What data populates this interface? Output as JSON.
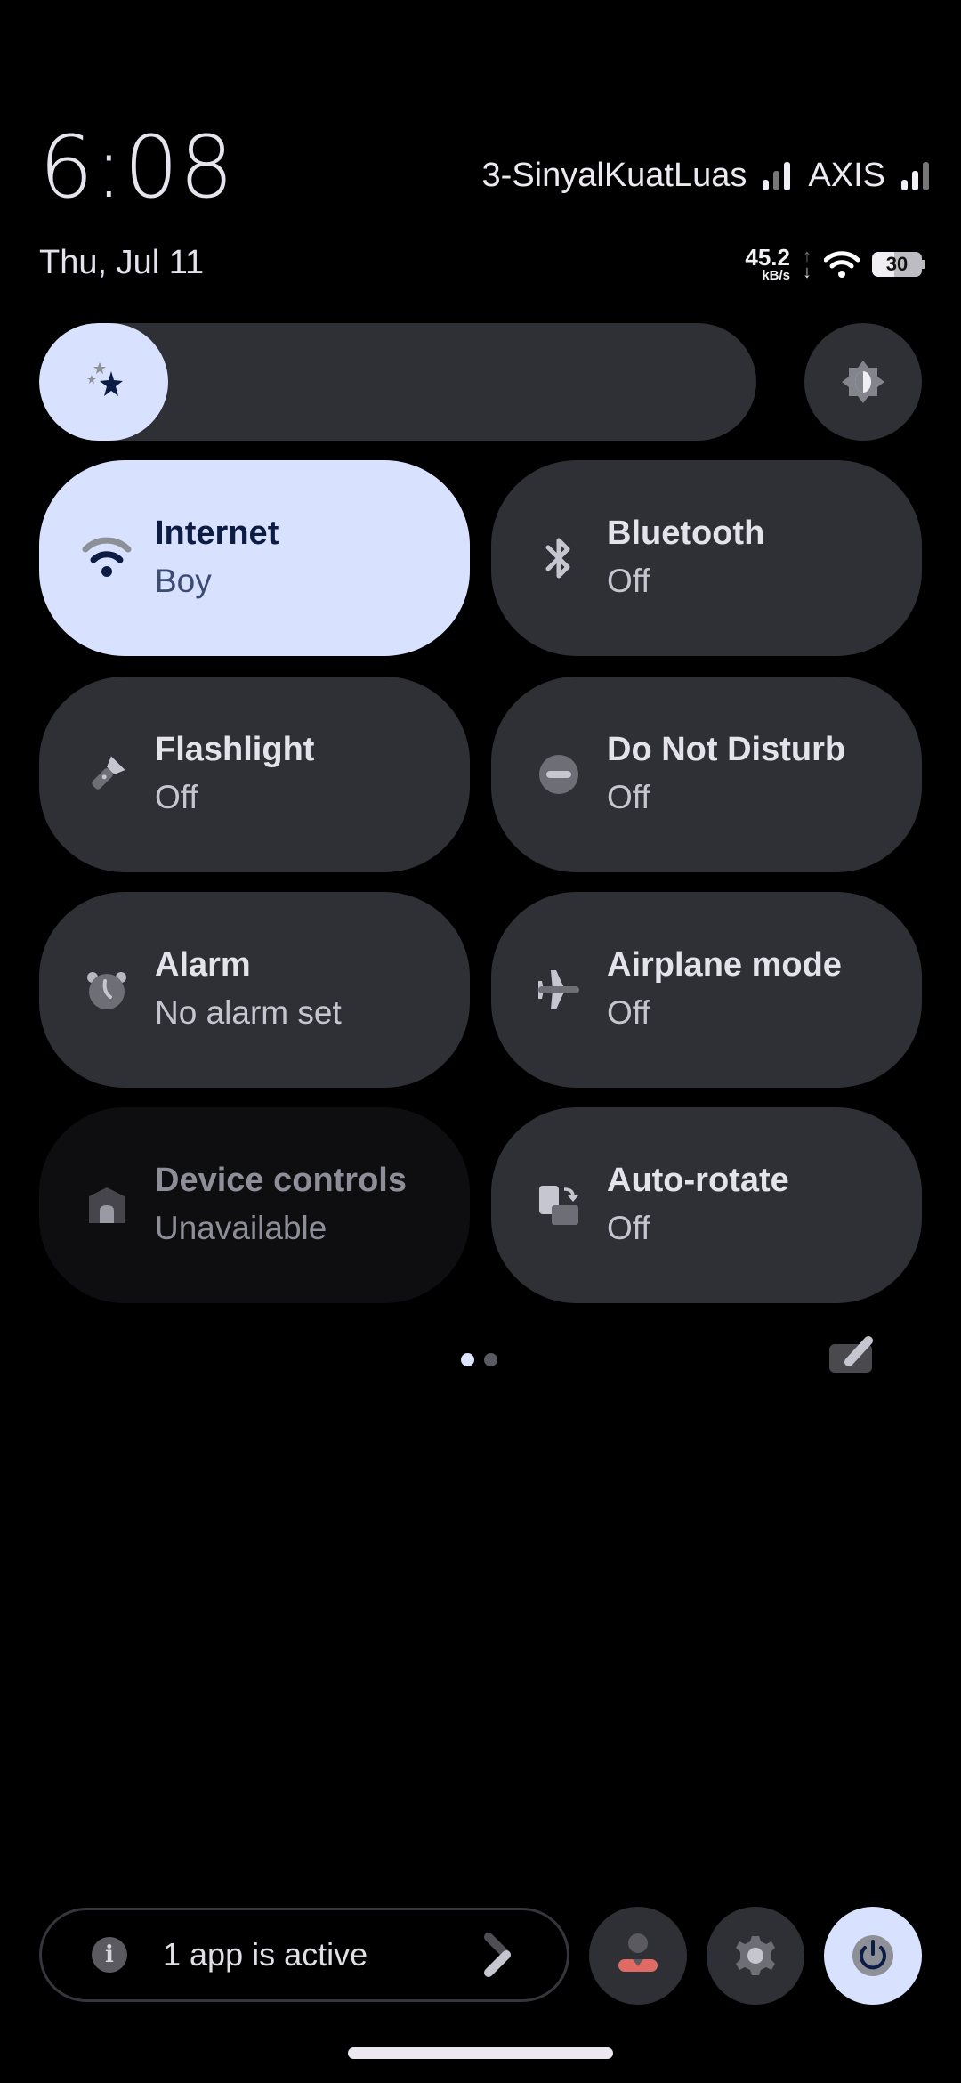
{
  "status_bar": {
    "time": "6:08",
    "date": "Thu, Jul 11",
    "carriers": [
      {
        "name": "3-SinyalKuatLuas",
        "signal_bars": 2,
        "max_bars": 3
      },
      {
        "name": "AXIS",
        "signal_bars": 2,
        "max_bars": 3
      }
    ],
    "network_speed": {
      "value": "45.2",
      "unit": "kB/s"
    },
    "battery_level": "30",
    "battery_percent": 30
  },
  "brightness": {
    "level_percent": 18,
    "icon": "stars-icon",
    "dark_mode_toggle_icon": "brightness-contrast-icon"
  },
  "tiles": [
    {
      "id": "internet",
      "label": "Internet",
      "sublabel": "Boy",
      "icon": "wifi-icon",
      "state": "active"
    },
    {
      "id": "bluetooth",
      "label": "Bluetooth",
      "sublabel": "Off",
      "icon": "bluetooth-icon",
      "state": "off"
    },
    {
      "id": "flashlight",
      "label": "Flashlight",
      "sublabel": "Off",
      "icon": "flashlight-icon",
      "state": "off"
    },
    {
      "id": "dnd",
      "label": "Do Not Disturb",
      "sublabel": "Off",
      "icon": "do-not-disturb-icon",
      "state": "off"
    },
    {
      "id": "alarm",
      "label": "Alarm",
      "sublabel": "No alarm set",
      "icon": "alarm-icon",
      "state": "off"
    },
    {
      "id": "airplane",
      "label": "Airplane mode",
      "sublabel": "Off",
      "icon": "airplane-icon",
      "state": "off"
    },
    {
      "id": "device-controls",
      "label": "Device controls",
      "sublabel": "Unavailable",
      "icon": "home-icon",
      "state": "unavailable"
    },
    {
      "id": "auto-rotate",
      "label": "Auto-rotate",
      "sublabel": "Off",
      "icon": "auto-rotate-icon",
      "state": "off"
    }
  ],
  "pager": {
    "current_page": 1,
    "total_pages": 2
  },
  "footer": {
    "active_apps_text": "1 app is active",
    "buttons": [
      "user-icon",
      "settings-icon",
      "power-icon"
    ]
  },
  "colors": {
    "accent": "#d8e2ff",
    "tile_bg": "#2f3036",
    "accent_text": "#0d1c45",
    "background": "#000000"
  }
}
